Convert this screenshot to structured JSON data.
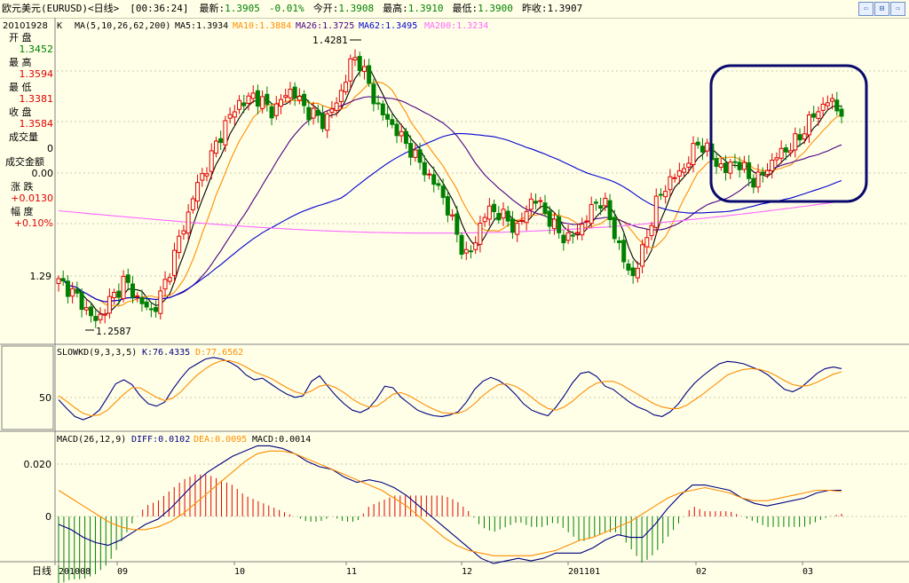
{
  "window": {
    "symbol": "欧元美元(EURUSD)<日线>",
    "time": "[00:36:24]",
    "latest_label": "最新:",
    "latest": "1.3905",
    "change": "-0.01%",
    "open_label": "今开:",
    "open": "1.3908",
    "high_label": "最高:",
    "high": "1.3910",
    "low_label": "最低:",
    "low": "1.3900",
    "prev_close_label": "昨收:",
    "prev_close": "1.3907"
  },
  "toolbar_icons": [
    "shrink-window-icon",
    "restore-window-icon",
    "expand-window-icon"
  ],
  "info_panel": {
    "date": "20101928",
    "open_label": "开  盘",
    "open_value": "1.3452",
    "high_label": "最  高",
    "high_value": "1.3594",
    "low_label": "最  低",
    "low_value": "1.3381",
    "close_label": "收  盘",
    "close_value": "1.3584",
    "volume_label": "成交量",
    "volume_value": "0",
    "amount_label": "成交金额",
    "amount_value": "0.00",
    "change_label": "涨  跌",
    "change_value": "+0.0130",
    "pct_label": "幅  度",
    "pct_value": "+0.10%",
    "price_tick": "1.29"
  },
  "ma_legend": {
    "k": "K",
    "params": "MA(5,10,26,62,200)",
    "ma5": "MA5:1.3934",
    "ma10": "MA10:1.3884",
    "ma26": "MA26:1.3725",
    "ma62": "MA62:1.3495",
    "ma200": "MA200:1.3234"
  },
  "annotations": {
    "high": "1.4281",
    "low": "1.2587"
  },
  "kd_legend": {
    "name": "SLOWKD(9,3,3,5)",
    "k": "K:76.4335",
    "d": "D:77.6562",
    "tick": "50"
  },
  "macd_legend": {
    "name": "MACD(26,12,9)",
    "diff": "DIFF:0.0102",
    "dea": "DEA:0.0095",
    "macd": "MACD:0.0014",
    "tick_top": "0.020",
    "tick_zero": "0"
  },
  "x_axis": {
    "period": "日线",
    "labels": [
      "201008",
      "09",
      "10",
      "11",
      "12",
      "201101",
      "02",
      "03"
    ]
  },
  "colors": {
    "up": "#e00000",
    "down": "#008000",
    "ma5": "#000000",
    "ma10": "#ff8c00",
    "ma26": "#4b0082",
    "ma62": "#0000cd",
    "ma200": "#ff66ff",
    "highlight": "#0a0a6e"
  },
  "chart_data": [
    {
      "type": "candlestick",
      "title": "欧元美元(EURUSD)<日线>",
      "x": [
        "2010-08",
        "2010-09",
        "2010-10",
        "2010-11",
        "2010-12",
        "2011-01",
        "2011-02",
        "2011-03"
      ],
      "close_path": [
        1.286,
        1.284,
        1.279,
        1.275,
        1.268,
        1.262,
        1.266,
        1.274,
        1.279,
        1.287,
        1.282,
        1.276,
        1.271,
        1.268,
        1.275,
        1.288,
        1.301,
        1.316,
        1.327,
        1.343,
        1.352,
        1.36,
        1.372,
        1.381,
        1.389,
        1.397,
        1.396,
        1.402,
        1.398,
        1.394,
        1.391,
        1.398,
        1.405,
        1.401,
        1.395,
        1.39,
        1.388,
        1.384,
        1.392,
        1.399,
        1.412,
        1.425,
        1.421,
        1.41,
        1.398,
        1.39,
        1.385,
        1.38,
        1.373,
        1.368,
        1.361,
        1.355,
        1.348,
        1.344,
        1.333,
        1.321,
        1.309,
        1.3,
        1.312,
        1.325,
        1.331,
        1.329,
        1.326,
        1.322,
        1.318,
        1.33,
        1.338,
        1.334,
        1.327,
        1.32,
        1.315,
        1.313,
        1.316,
        1.322,
        1.329,
        1.337,
        1.334,
        1.322,
        1.308,
        1.295,
        1.29,
        1.301,
        1.316,
        1.332,
        1.342,
        1.348,
        1.352,
        1.356,
        1.364,
        1.372,
        1.369,
        1.362,
        1.358,
        1.354,
        1.362,
        1.357,
        1.352,
        1.347,
        1.353,
        1.358,
        1.364,
        1.367,
        1.37,
        1.374,
        1.382,
        1.388,
        1.393,
        1.398,
        1.395,
        1.391
      ],
      "high": 1.4281,
      "low": 1.2587,
      "ylabel": "1.29"
    },
    {
      "type": "line",
      "title": "SLOWKD(9,3,3,5)",
      "series": [
        {
          "name": "K",
          "values": [
            35,
            24,
            14,
            10,
            14,
            22,
            38,
            55,
            60,
            54,
            40,
            30,
            27,
            32,
            48,
            62,
            74,
            80,
            86,
            88,
            86,
            82,
            76,
            66,
            60,
            62,
            55,
            48,
            42,
            38,
            40,
            58,
            65,
            52,
            40,
            30,
            22,
            19,
            24,
            36,
            52,
            50,
            38,
            30,
            22,
            18,
            15,
            14,
            16,
            20,
            32,
            48,
            58,
            63,
            59,
            52,
            42,
            30,
            22,
            18,
            15,
            26,
            40,
            56,
            68,
            70,
            64,
            52,
            48,
            40,
            32,
            26,
            22,
            16,
            14,
            20,
            30,
            44,
            56,
            65,
            73,
            80,
            83,
            82,
            80,
            76,
            72,
            66,
            57,
            48,
            45,
            50,
            59,
            68,
            74,
            76,
            74
          ]
        },
        {
          "name": "D",
          "values": [
            40,
            33,
            25,
            18,
            15,
            16,
            22,
            32,
            42,
            50,
            50,
            44,
            38,
            34,
            37,
            45,
            56,
            66,
            74,
            80,
            84,
            84,
            81,
            76,
            70,
            66,
            62,
            56,
            50,
            45,
            42,
            46,
            52,
            54,
            50,
            44,
            36,
            30,
            26,
            27,
            34,
            42,
            44,
            40,
            34,
            28,
            23,
            19,
            18,
            18,
            22,
            30,
            40,
            48,
            54,
            55,
            52,
            46,
            38,
            30,
            24,
            22,
            26,
            33,
            42,
            50,
            56,
            58,
            58,
            54,
            48,
            42,
            36,
            30,
            26,
            24,
            24,
            28,
            35,
            42,
            50,
            58,
            66,
            70,
            73,
            74,
            73,
            70,
            65,
            59,
            54,
            52,
            53,
            57,
            62,
            67,
            70
          ]
        }
      ],
      "ylabel": "50"
    },
    {
      "type": "bar",
      "title": "MACD(26,12,9)",
      "series": [
        {
          "name": "DIFF",
          "values": [
            -0.003,
            -0.005,
            -0.008,
            -0.01,
            -0.011,
            -0.009,
            -0.006,
            -0.003,
            -0.001,
            0.003,
            0.008,
            0.013,
            0.017,
            0.02,
            0.023,
            0.025,
            0.027,
            0.027,
            0.026,
            0.024,
            0.021,
            0.019,
            0.018,
            0.015,
            0.013,
            0.014,
            0.013,
            0.011,
            0.008,
            0.004,
            0.0,
            -0.004,
            -0.008,
            -0.012,
            -0.016,
            -0.018,
            -0.017,
            -0.016,
            -0.017,
            -0.016,
            -0.014,
            -0.014,
            -0.014,
            -0.012,
            -0.009,
            -0.007,
            -0.008,
            -0.008,
            -0.003,
            0.003,
            0.008,
            0.012,
            0.012,
            0.011,
            0.01,
            0.007,
            0.005,
            0.004,
            0.005,
            0.006,
            0.007,
            0.009,
            0.01,
            0.01
          ]
        },
        {
          "name": "DEA",
          "values": [
            0.01,
            0.007,
            0.004,
            0.001,
            -0.002,
            -0.004,
            -0.005,
            -0.005,
            -0.004,
            -0.002,
            0.001,
            0.005,
            0.009,
            0.013,
            0.017,
            0.021,
            0.024,
            0.025,
            0.025,
            0.024,
            0.022,
            0.02,
            0.018,
            0.016,
            0.014,
            0.012,
            0.01,
            0.007,
            0.004,
            0.0,
            -0.004,
            -0.008,
            -0.011,
            -0.013,
            -0.014,
            -0.015,
            -0.015,
            -0.015,
            -0.015,
            -0.014,
            -0.013,
            -0.011,
            -0.009,
            -0.008,
            -0.006,
            -0.004,
            -0.002,
            0.001,
            0.004,
            0.007,
            0.009,
            0.01,
            0.011,
            0.01,
            0.009,
            0.007,
            0.006,
            0.006,
            0.007,
            0.008,
            0.009,
            0.01,
            0.01,
            0.0095
          ]
        }
      ],
      "ylabel": "0.020"
    }
  ]
}
